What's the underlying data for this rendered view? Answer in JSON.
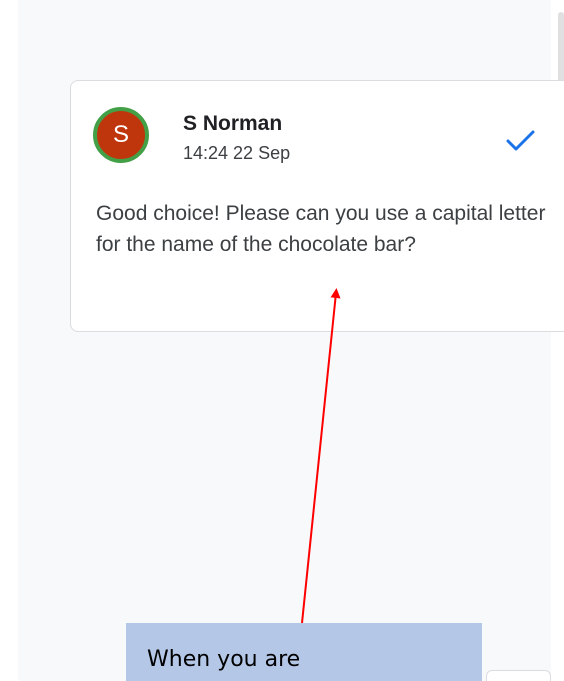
{
  "comment": {
    "avatar_initial": "S",
    "author": "S Norman",
    "timestamp": "14:24 22 Sep",
    "text": "Good choice! Please can you use a capital letter for the name of the chocolate bar?",
    "resolve_icon": "checkmark-icon",
    "resolved_color": "#1a73e8",
    "avatar_color": "#bf360c",
    "avatar_ring_color": "#43a047"
  },
  "annotation": {
    "callout_text": "When you are",
    "callout_color": "#b4c7e7",
    "arrow_color": "#ff0000"
  }
}
